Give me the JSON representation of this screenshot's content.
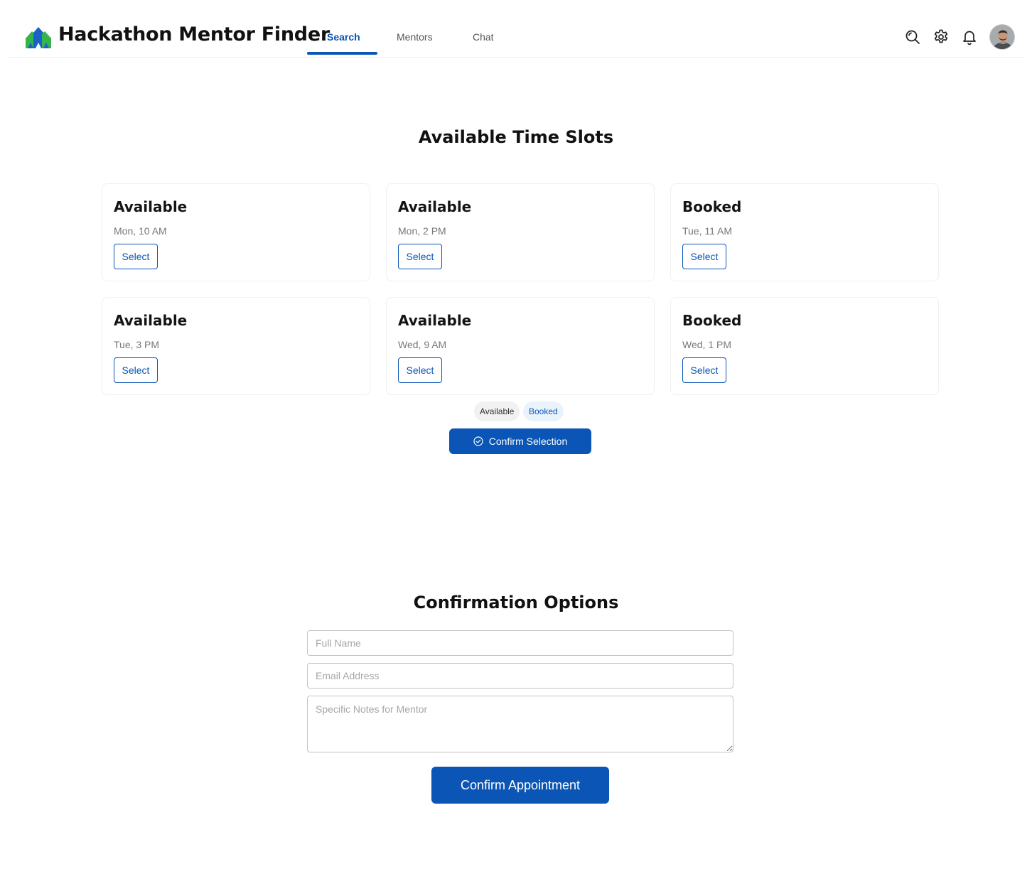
{
  "header": {
    "app_title": "Hackathon Mentor Finder",
    "tabs": [
      {
        "label": "Search",
        "active": true
      },
      {
        "label": "Mentors",
        "active": false
      },
      {
        "label": "Chat",
        "active": false
      }
    ],
    "icons": [
      "logo-icon",
      "search-icon",
      "gear-icon",
      "bell-icon",
      "avatar"
    ]
  },
  "slots_section": {
    "title": "Available Time Slots",
    "slots": [
      {
        "status": "Available",
        "time": "Mon, 10 AM",
        "button": "Select"
      },
      {
        "status": "Available",
        "time": "Mon, 2 PM",
        "button": "Select"
      },
      {
        "status": "Booked",
        "time": "Tue, 11 AM",
        "button": "Select"
      },
      {
        "status": "Available",
        "time": "Tue, 3 PM",
        "button": "Select"
      },
      {
        "status": "Available",
        "time": "Wed, 9 AM",
        "button": "Select"
      },
      {
        "status": "Booked",
        "time": "Wed, 1 PM",
        "button": "Select"
      }
    ],
    "legend": {
      "available": "Available",
      "booked": "Booked"
    },
    "confirm_button": "Confirm Selection"
  },
  "confirmation": {
    "title": "Confirmation Options",
    "full_name_placeholder": "Full Name",
    "email_placeholder": "Email Address",
    "notes_placeholder": "Specific Notes for Mentor",
    "submit_label": "Confirm Appointment"
  },
  "colors": {
    "accent": "#0a55b5",
    "logo_green": "#34b44a",
    "logo_blue": "#1a62c8",
    "booked_chip_bg": "#eaf3fc",
    "available_chip_bg": "#f1f1f1"
  }
}
